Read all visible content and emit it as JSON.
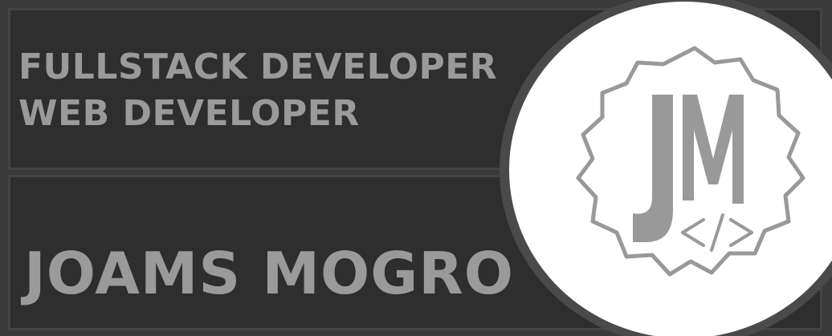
{
  "banner": {
    "role_line_1": "FULLSTACK DEVELOPER",
    "role_line_2": "WEB DEVELOPER",
    "name": "JOAMS MOGRO"
  },
  "logo": {
    "monogram": "JM",
    "code_symbol": "</>"
  },
  "colors": {
    "background": "#3a3a3a",
    "panel": "#2e2e2e",
    "text": "#9a9a9a",
    "logo_background": "#ffffff",
    "logo_mark": "#999999"
  }
}
